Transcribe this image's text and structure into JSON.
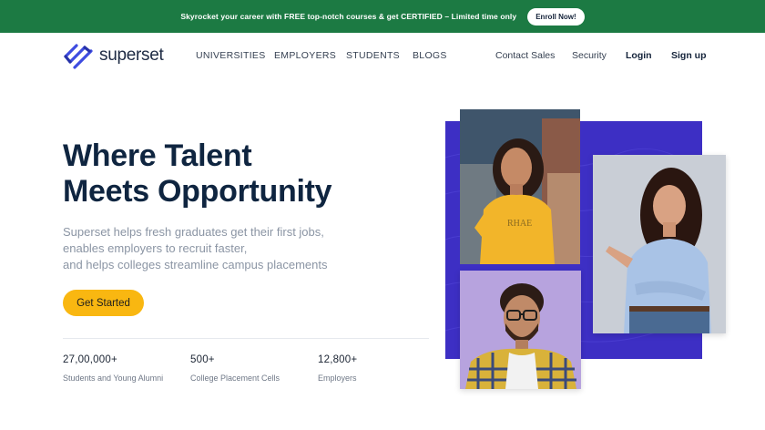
{
  "promo": {
    "text": "Skyrocket your career with FREE top-notch courses & get CERTIFIED – Limited time only",
    "button_label": "Enroll Now!",
    "background": "#1c7a43"
  },
  "nav": {
    "logo_text": "superset",
    "primary_links": [
      "UNIVERSITIES",
      "EMPLOYERS",
      "STUDENTS",
      "BLOGS"
    ],
    "secondary_links": [
      "Contact Sales",
      "Security"
    ],
    "login_label": "Login",
    "signup_label": "Sign up"
  },
  "hero": {
    "title_lines": [
      "Where Talent",
      "Meets Opportunity"
    ],
    "subtitle_lines": [
      "Superset helps fresh graduates get their first jobs,",
      "enables employers to recruit faster,",
      "and helps colleges streamline campus placements"
    ],
    "cta_label": "Get Started",
    "cta_color": "#f9b711"
  },
  "stats": [
    {
      "value": "27,00,000+",
      "label": "Students and Young Alumni"
    },
    {
      "value": "500+",
      "label": "College Placement Cells"
    },
    {
      "value": "12,800+",
      "label": "Employers"
    }
  ],
  "collage": {
    "panel_color": "#3d2fc4",
    "photos": [
      "student-in-yellow-tshirt",
      "student-pointing",
      "student-with-glasses"
    ]
  }
}
